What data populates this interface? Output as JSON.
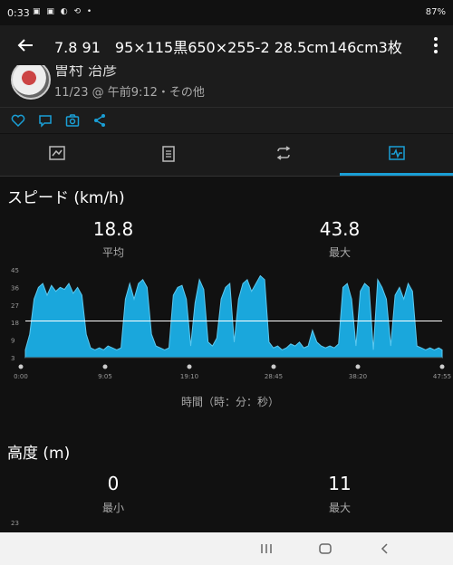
{
  "status_bar": {
    "time": "0:33",
    "notification_icons": "▣ ▣ ◐ ⟲ •",
    "right_text": "87%"
  },
  "app_bar": {
    "title": "7.8 91　95×115黒650×255-2 28.5cm146cm3枚"
  },
  "activity": {
    "user_name": "曽村 治彦",
    "meta": "11/23 @ 午前9:12・その他"
  },
  "speed": {
    "title": "スピード (km/h)",
    "avg_value": "18.8",
    "avg_label": "平均",
    "max_value": "43.8",
    "max_label": "最大"
  },
  "altitude": {
    "title": "高度 (m)",
    "min_value": "0",
    "min_label": "最小",
    "max_value": "11",
    "max_label": "最大",
    "axis_top_tick": "23"
  },
  "chart_data": {
    "type": "area",
    "title": "",
    "xlabel": "時間（時：分：秒）",
    "ylabel": "",
    "x_tick_labels": [
      "0:00",
      "9:05",
      "19:10",
      "28:45",
      "38:20",
      "47:55"
    ],
    "y_tick_labels": [
      "3",
      "9",
      "18",
      "27",
      "36",
      "45"
    ],
    "ylim": [
      0,
      45
    ],
    "reference_line": {
      "value": 18.8,
      "label": "平均"
    },
    "color": "#1aa7dc",
    "series": [
      {
        "x": [
          0,
          0.5,
          1,
          1.5,
          2,
          2.5,
          3,
          3.5,
          4,
          4.5,
          5,
          5.5,
          6,
          6.5,
          7,
          7.5,
          8,
          8.5,
          9,
          9.5,
          10,
          10.5,
          11,
          11.5,
          12,
          12.5,
          13,
          13.5,
          14,
          14.5,
          15,
          15.5,
          16,
          16.5,
          17,
          17.5,
          18,
          18.5,
          19,
          19.5,
          20,
          20.5,
          21,
          21.5,
          22,
          22.5,
          23,
          23.5,
          24,
          24.5,
          25,
          25.5,
          26,
          26.5,
          27,
          27.5,
          28,
          28.5,
          29,
          29.5,
          30,
          30.5,
          31,
          31.5,
          32,
          32.5,
          33,
          33.5,
          34,
          34.5,
          35,
          35.5,
          36,
          36.5,
          37,
          37.5,
          38,
          38.5,
          39,
          39.5,
          40,
          40.5,
          41,
          41.5,
          42,
          42.5,
          43,
          43.5,
          44,
          44.5,
          45,
          45.5,
          46,
          46.5,
          47,
          47.5,
          47.9
        ],
        "values": [
          4,
          12,
          30,
          36,
          38,
          32,
          37,
          34,
          36,
          35,
          38,
          33,
          36,
          32,
          12,
          5,
          4,
          5,
          4,
          6,
          5,
          4,
          5,
          30,
          38,
          30,
          38,
          40,
          36,
          12,
          6,
          5,
          4,
          5,
          32,
          36,
          37,
          30,
          6,
          28,
          40,
          35,
          8,
          6,
          10,
          30,
          36,
          38,
          8,
          30,
          38,
          40,
          34,
          38,
          42,
          40,
          8,
          5,
          6,
          4,
          5,
          7,
          6,
          8,
          5,
          6,
          14,
          8,
          6,
          5,
          6,
          5,
          7,
          36,
          38,
          30,
          6,
          34,
          38,
          36,
          4,
          40,
          36,
          30,
          6,
          32,
          36,
          30,
          38,
          34,
          6,
          5,
          4,
          5,
          4,
          5,
          4
        ]
      }
    ]
  }
}
